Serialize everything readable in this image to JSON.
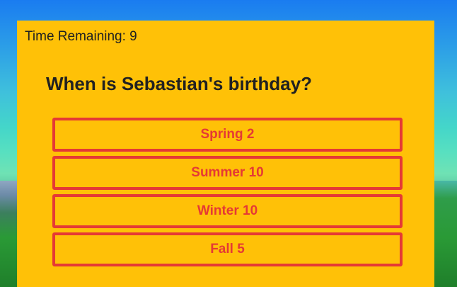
{
  "quiz": {
    "timer_label": "Time Remaining: 9",
    "question": "When is Sebastian's birthday?",
    "answers": [
      {
        "label": "Spring 2"
      },
      {
        "label": "Summer 10"
      },
      {
        "label": "Winter 10"
      },
      {
        "label": "Fall 5"
      }
    ]
  },
  "colors": {
    "panel": "#ffc107",
    "answer_accent": "#e53935",
    "text": "#212121"
  }
}
